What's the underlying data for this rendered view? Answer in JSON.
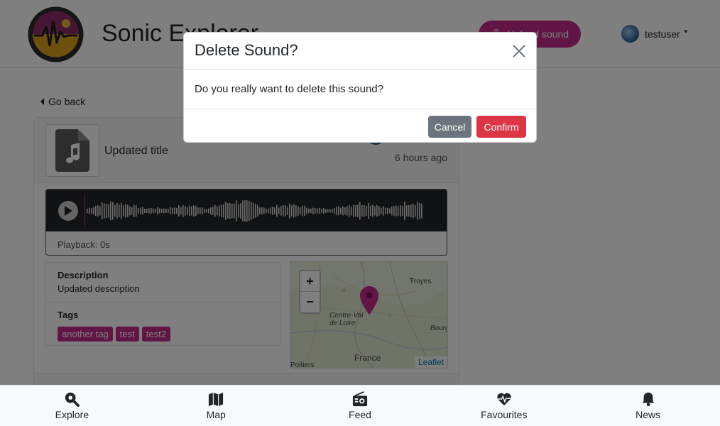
{
  "header": {
    "app_title": "Sonic Explorer",
    "upload_label": "Upload sound",
    "username": "testuser"
  },
  "page": {
    "go_back": "Go back",
    "sound_title": "Updated title",
    "time_ago": "6 hours ago",
    "playback": "Playback: 0s",
    "description_label": "Description",
    "description": "Updated description",
    "tags_label": "Tags",
    "tags": [
      "another tag",
      "test",
      "test2"
    ],
    "map": {
      "attribution": "Leaflet",
      "zoom_in": "+",
      "zoom_out": "−",
      "labels": [
        "Troyes",
        "Centre-Val de Loire",
        "France",
        "Bourg",
        "Poitiers"
      ]
    }
  },
  "modal": {
    "title": "Delete Sound?",
    "body": "Do you really want to delete this sound?",
    "cancel": "Cancel",
    "confirm": "Confirm"
  },
  "nav": {
    "items": [
      {
        "label": "Explore",
        "icon": "magnify-icon"
      },
      {
        "label": "Map",
        "icon": "map-icon"
      },
      {
        "label": "Feed",
        "icon": "radio-icon"
      },
      {
        "label": "Favourites",
        "icon": "heart-pulse-icon"
      },
      {
        "label": "News",
        "icon": "bell-icon"
      }
    ]
  },
  "colors": {
    "accent": "#c02a8a",
    "danger": "#dc3545",
    "secondary": "#6c757d"
  }
}
